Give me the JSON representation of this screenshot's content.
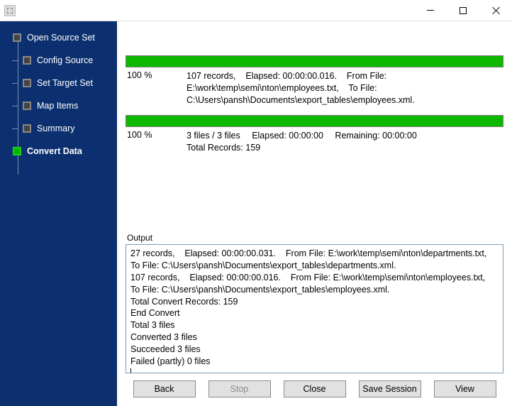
{
  "sidebar": {
    "items": [
      {
        "label": "Open Source Set"
      },
      {
        "label": "Config Source"
      },
      {
        "label": "Set Target Set"
      },
      {
        "label": "Map Items"
      },
      {
        "label": "Summary"
      },
      {
        "label": "Convert Data"
      }
    ]
  },
  "progress": {
    "file": {
      "pct": "100 %",
      "records": "107 records,",
      "elapsed": "Elapsed: 00:00:00.016.",
      "from_label": "From File:",
      "from_path": "E:\\work\\temp\\semi\\nton\\employees.txt,",
      "to_label": "To File:",
      "to_path": "C:\\Users\\pansh\\Documents\\export_tables\\employees.xml."
    },
    "total": {
      "pct": "100 %",
      "files": "3 files / 3 files",
      "elapsed": "Elapsed: 00:00:00",
      "remaining": "Remaining: 00:00:00",
      "total_records": "Total Records: 159"
    }
  },
  "output": {
    "label": "Output",
    "lines": [
      "27 records,    Elapsed: 00:00:00.031.    From File: E:\\work\\temp\\semi\\nton\\departments.txt,    To File: C:\\Users\\pansh\\Documents\\export_tables\\departments.xml.",
      "107 records,    Elapsed: 00:00:00.016.    From File: E:\\work\\temp\\semi\\nton\\employees.txt,    To File: C:\\Users\\pansh\\Documents\\export_tables\\employees.xml.",
      "Total Convert Records: 159",
      "End Convert",
      "Total 3 files",
      "Converted 3 files",
      "Succeeded 3 files",
      "Failed (partly) 0 files"
    ]
  },
  "buttons": {
    "back": "Back",
    "stop": "Stop",
    "close": "Close",
    "save_session": "Save Session",
    "view": "View"
  },
  "colors": {
    "sidebar": "#0c306f",
    "progress_fill": "#0fb800"
  }
}
